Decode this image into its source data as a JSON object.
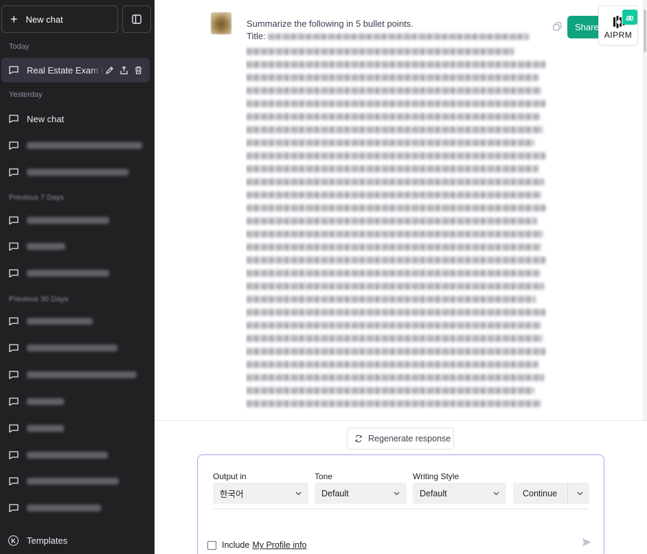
{
  "sidebar": {
    "new_chat_label": "New chat",
    "sections": {
      "today": "Today",
      "yesterday": "Yesterday",
      "previous_7": "Previous 7 Days",
      "previous_30": "Previous 30 Days"
    },
    "items": [
      {
        "label": "Real Estate Exam Pre",
        "active": true
      },
      {
        "label": "New chat"
      }
    ],
    "templates_label": "Templates",
    "icons": {
      "plus": "plus-icon",
      "toggle": "sidebar-toggle-icon",
      "message": "message-icon",
      "edit": "pencil-icon",
      "share": "share-icon",
      "delete": "trash-icon",
      "templates": "k-circle-icon"
    }
  },
  "conversation": {
    "user_message_line1": "Summarize the following in 5 bullet points.",
    "title_prefix": "Title: "
  },
  "toolbar": {
    "share_label": "Share",
    "aiprm_label": "AIPRM",
    "ae_badge": "æ"
  },
  "regenerate_label": "Regenerate response",
  "prompt_panel": {
    "output_label": "Output in",
    "output_value": "한국어",
    "tone_label": "Tone",
    "tone_value": "Default",
    "style_label": "Writing Style",
    "style_value": "Default",
    "continue_label": "Continue",
    "include_text": "Include",
    "profile_link": "My Profile info"
  },
  "colors": {
    "sidebar_bg": "#202123",
    "active_item_bg": "#343541",
    "share_green": "#10a37f",
    "panel_border": "#a5a3ea",
    "ae_badge": "#10c9a1"
  }
}
